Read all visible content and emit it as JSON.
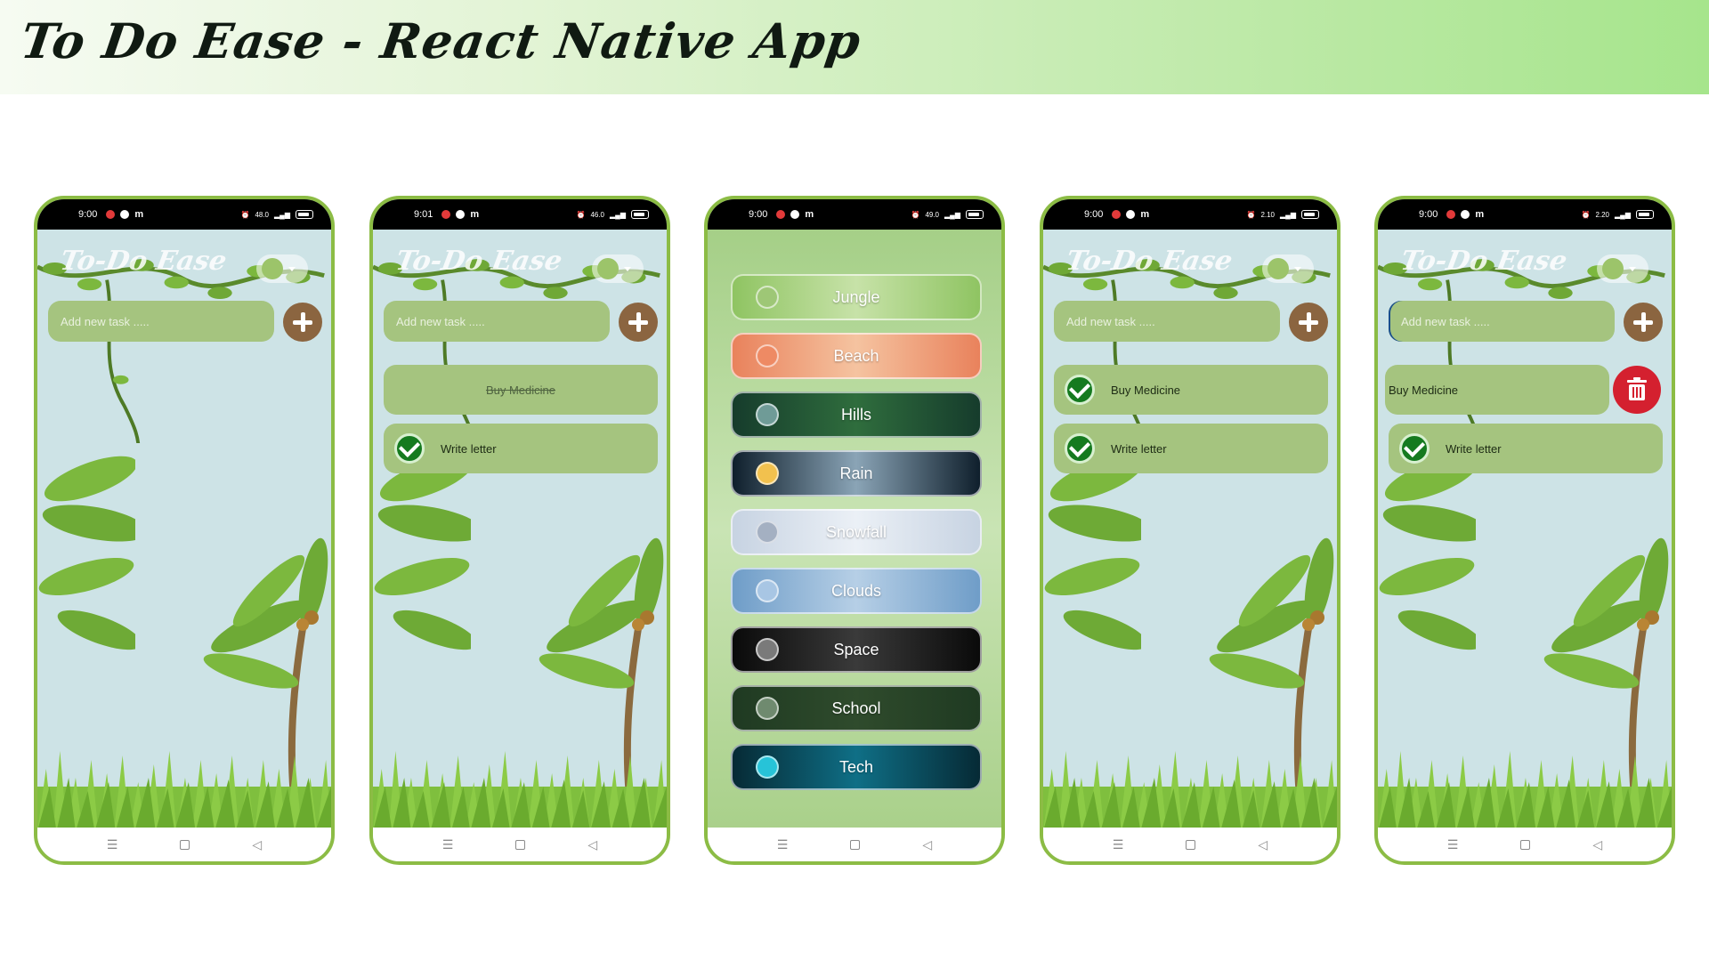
{
  "banner": {
    "title": "To Do Ease - React Native App"
  },
  "common": {
    "app_title": "To-Do Ease",
    "input_placeholder": "Add new task .....",
    "carrier_icon": "m"
  },
  "phones": [
    {
      "time": "9:00",
      "speed": "48.0",
      "tasks": []
    },
    {
      "time": "9:01",
      "speed": "46.0",
      "tasks": [
        {
          "label": "Buy Medicine",
          "state": "completed-strikethrough"
        },
        {
          "label": "Write letter",
          "state": "checked"
        }
      ]
    },
    {
      "time": "9:00",
      "speed": "49.0"
    },
    {
      "time": "9:00",
      "speed": "2.10",
      "tasks": [
        {
          "label": "Buy Medicine",
          "state": "checked"
        },
        {
          "label": "Write letter",
          "state": "checked"
        }
      ]
    },
    {
      "time": "9:00",
      "speed": "2.20",
      "tasks": [
        {
          "label": "Buy Medicine",
          "state": "swiped-delete"
        },
        {
          "label": "Write letter",
          "state": "checked"
        }
      ]
    }
  ],
  "themes": [
    {
      "label": "Jungle",
      "colors": [
        "#8fc462",
        "#c7e2a8"
      ],
      "radio": "#9ec776"
    },
    {
      "label": "Beach",
      "colors": [
        "#e9825c",
        "#f5c3a0"
      ],
      "radio": "#ee8a64"
    },
    {
      "label": "Hills",
      "colors": [
        "#163c2c",
        "#2f6d3d"
      ],
      "radio": "#6f9b97"
    },
    {
      "label": "Rain",
      "colors": [
        "#0f1f2c",
        "#8aa4b6"
      ],
      "radio": "#f2c14e"
    },
    {
      "label": "Snowfall",
      "colors": [
        "#c7d3e2",
        "#ebf0f6"
      ],
      "radio": "#a4b0c2"
    },
    {
      "label": "Clouds",
      "colors": [
        "#6f9dc8",
        "#b6cfe6"
      ],
      "radio": "#a8c6e4"
    },
    {
      "label": "Space",
      "colors": [
        "#0a0a0a",
        "#3a3a3a"
      ],
      "radio": "#7a7a7a"
    },
    {
      "label": "School",
      "colors": [
        "#1f3a22",
        "#2f4b2c"
      ],
      "radio": "#6f8a6f"
    },
    {
      "label": "Tech",
      "colors": [
        "#062a35",
        "#0f6f86"
      ],
      "radio": "#27c3d8"
    }
  ],
  "nav": {
    "menu_icon": "☰",
    "back_icon": "◁"
  }
}
